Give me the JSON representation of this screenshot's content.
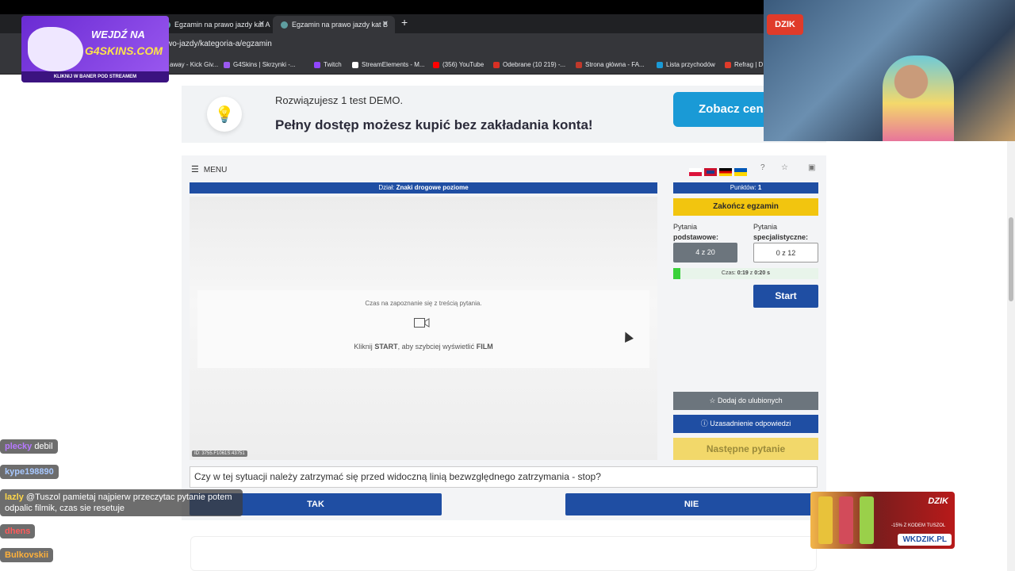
{
  "browser": {
    "tabs": [
      {
        "title": "Egzamin na prawo jazdy kat A",
        "active": false
      },
      {
        "title": "Egzamin na prawo jazdy kat B",
        "active": true
      }
    ],
    "url": "wo-jazdy/kategoria-a/egzamin",
    "bookmarks": [
      {
        "label": "away - Kick Giv...",
        "color": "#e0a030"
      },
      {
        "label": "G4Skins | Skrzynki -...",
        "color": "#9b59f0"
      },
      {
        "label": "Twitch",
        "color": "#9146ff"
      },
      {
        "label": "StreamElements - M...",
        "color": "#ffffff"
      },
      {
        "label": "(356) YouTube",
        "color": "#ff0000"
      },
      {
        "label": "Odebrane (10 219) -...",
        "color": "#d93025"
      },
      {
        "label": "Strona główna - FA...",
        "color": "#c0392b"
      },
      {
        "label": "Lista przychodów",
        "color": "#1a9ad6"
      },
      {
        "label": "Refrag | D",
        "color": "#e03b2a"
      }
    ]
  },
  "promo": {
    "line1": "Rozwiązujesz 1 test DEMO.",
    "line2": "Pełny dostęp możesz kupić bez zakładania konta!",
    "button": "Zobacz cen"
  },
  "exam": {
    "menu_label": "MENU",
    "category_prefix": "Dział:",
    "category": "Znaki drogowe poziome",
    "points_label": "Punktów:",
    "points_value": "1",
    "finish_button": "Zakończ egzamin",
    "basic_label_1": "Pytania",
    "basic_label_2": "podstawowe:",
    "spec_label_1": "Pytania",
    "spec_label_2": "specjalistyczne:",
    "basic_progress": "4 z 20",
    "spec_progress": "0 z 12",
    "timer_prefix": "Czas:",
    "timer_elapsed": "0:19",
    "timer_mid": "z",
    "timer_total": "0:20 s",
    "timer_fraction": 0.05,
    "start_button": "Start",
    "media_hint": "Czas na zapoznanie się z treścią pytania.",
    "media_action_1": "Kliknij",
    "media_action_start": "START",
    "media_action_2": ", aby szybciej wyświetlić",
    "media_action_film": "FILM",
    "media_id": "ID: 3755.F1061S:43751",
    "favorite_button": "Dodaj do ulubionych",
    "explain_button": "Uzasadnienie odpowiedzi",
    "next_button": "Następne pytanie",
    "question": "Czy w tej sytuacji należy zatrzymać się przed widoczną linią bezwzględnego zatrzymania - stop?",
    "answer_yes": "TAK",
    "answer_no": "NIE"
  },
  "overlay": {
    "g4_line1": "WEJDŹ NA",
    "g4_line2": "G4SKINS.COM",
    "g4_line3": "KLIKNIJ W BANER POD STREAMEM",
    "cam_logo": "DZIK",
    "dzik_logo": "DZIK",
    "dzik_code": "-15% Z KODEM TUSZOL",
    "dzik_url": "WKDZIK.PL"
  },
  "chat": [
    {
      "user": "plecky",
      "text": "debil"
    },
    {
      "user": "kype198890",
      "text": ""
    },
    {
      "user": "lazly",
      "text": "@Tuszol pamietaj najpierw przeczytac pytanie potem odpalic filmik, czas sie resetuje"
    },
    {
      "user": "dhens",
      "text": ""
    },
    {
      "user": "Bulkovskii",
      "text": ""
    }
  ]
}
